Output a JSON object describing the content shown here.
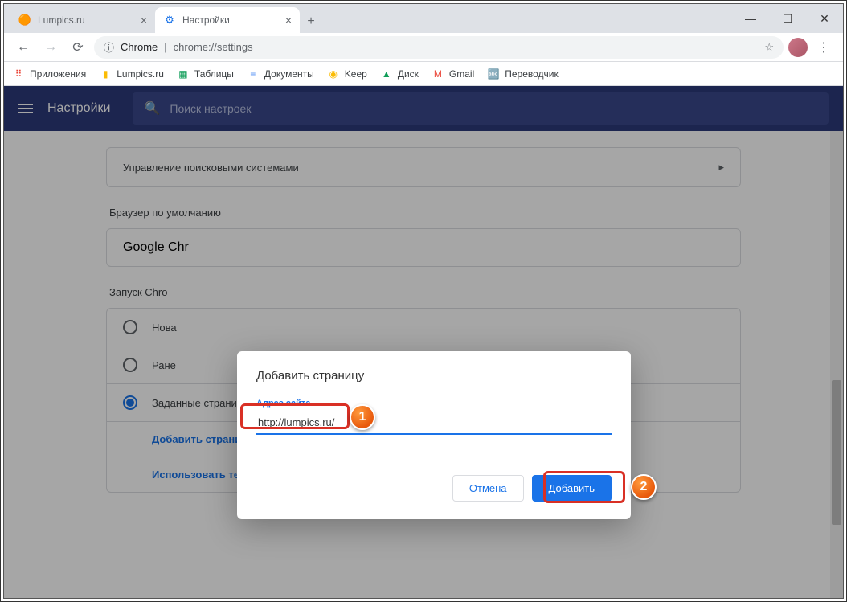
{
  "window": {
    "minimize": "—",
    "maximize": "☐",
    "close": "✕"
  },
  "tabs": [
    {
      "title": "Lumpics.ru",
      "icon": "🟠"
    },
    {
      "title": "Настройки",
      "icon": "⚙"
    }
  ],
  "newtab": "+",
  "nav": {
    "back": "←",
    "forward": "→",
    "reload": "⟳"
  },
  "addr": {
    "secure": "ⓘ",
    "scheme": "Chrome",
    "sep": "|",
    "path": "chrome://settings",
    "star": "☆",
    "menu": "⋮"
  },
  "bookmarks": [
    {
      "icon": "⠿",
      "label": "Приложения",
      "color": "#ea4335"
    },
    {
      "icon": "▮",
      "label": "Lumpics.ru",
      "color": "#fbbc04"
    },
    {
      "icon": "▦",
      "label": "Таблицы",
      "color": "#0f9d58"
    },
    {
      "icon": "≡",
      "label": "Документы",
      "color": "#4285f4"
    },
    {
      "icon": "◉",
      "label": "Keep",
      "color": "#fbbc04"
    },
    {
      "icon": "▲",
      "label": "Диск",
      "color": "#0f9d58"
    },
    {
      "icon": "M",
      "label": "Gmail",
      "color": "#ea4335"
    },
    {
      "icon": "🔤",
      "label": "Переводчик",
      "color": "#4285f4"
    }
  ],
  "appbar": {
    "title": "Настройки",
    "search_placeholder": "Поиск настроек"
  },
  "settings": {
    "search_engines": "Управление поисковыми системами",
    "default_browser_heading": "Браузер по умолчанию",
    "default_browser_value": "Google Chr",
    "startup_heading": "Запуск Chro",
    "radio_newtab": "Нова",
    "radio_prev": "Ране",
    "radio_pages": "Заданные страницы",
    "add_page": "Добавить страницу",
    "use_current": "Использовать текущие страницы",
    "chevron": "▸"
  },
  "dialog": {
    "title": "Добавить страницу",
    "field_label": "Адрес сайта",
    "field_value": "http://lumpics.ru/",
    "cancel": "Отмена",
    "submit": "Добавить"
  },
  "markers": {
    "one": "1",
    "two": "2"
  }
}
